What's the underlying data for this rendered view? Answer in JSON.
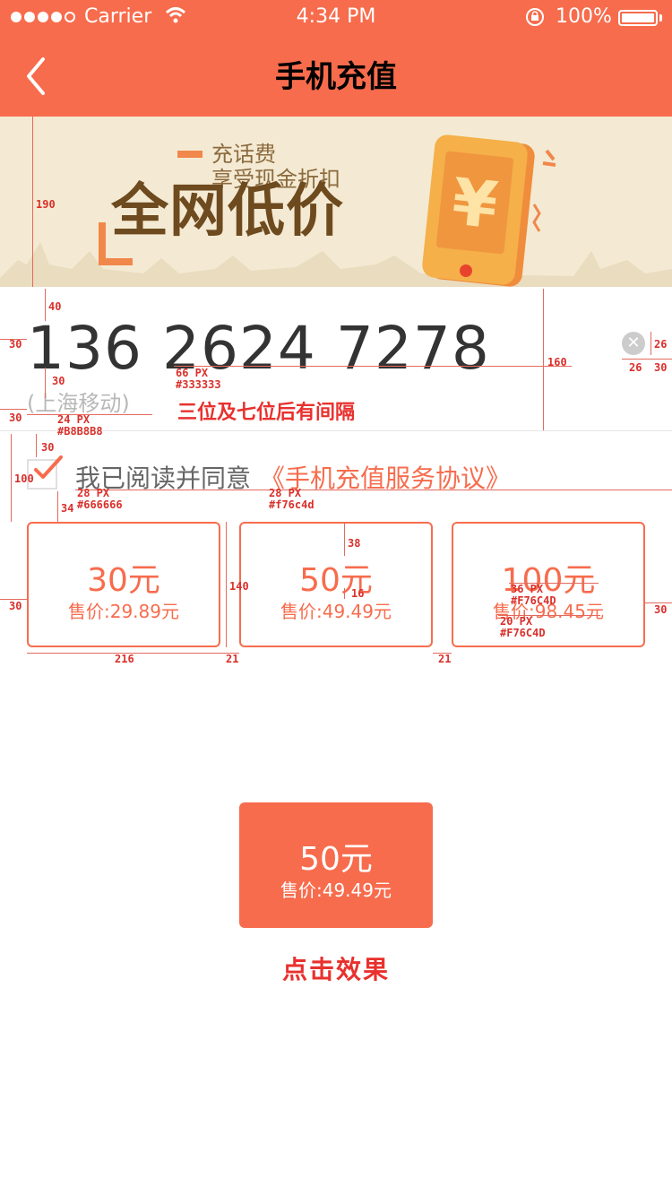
{
  "status_bar": {
    "carrier": "Carrier",
    "time": "4:34 PM",
    "battery": "100%"
  },
  "nav": {
    "title": "手机充值"
  },
  "banner": {
    "line1": "充话费",
    "line2": "享受现金折扣",
    "headline": "全网低价"
  },
  "phone": {
    "number": "136 2624 7278",
    "operator": "(上海移动)"
  },
  "agreement": {
    "text": "我已阅读并同意",
    "link": "《手机充值服务协议》",
    "checked": true
  },
  "options": [
    {
      "amount": "30元",
      "price": "售价:29.89元"
    },
    {
      "amount": "50元",
      "price": "售价:49.49元"
    },
    {
      "amount": "100元",
      "price": "售价:98.45元"
    }
  ],
  "pressed_option": {
    "amount": "50元",
    "price": "售价:49.49元"
  },
  "colors": {
    "accent": "#f76c4d",
    "phone_text": "#333333",
    "operator_text": "#b8b8b8",
    "agree_text": "#666666",
    "banner_bg": "#f4ead3"
  },
  "annotations": {
    "banner_height": "190",
    "phone_top": "40",
    "left_30a": "30",
    "left_30b": "30",
    "gap_30": "30",
    "phone_size": "66 PX",
    "phone_color": "#333333",
    "operator_size": "24 PX",
    "operator_color": "#B8B8B8",
    "row_height": "160",
    "clear_size": "26",
    "clear_right_26": "26",
    "clear_right_30": "30",
    "agree_row": "100",
    "agree_top": "30",
    "agree_bottom": "34",
    "agree_size": "28 PX",
    "agree_color": "#666666",
    "link_size": "28 PX",
    "link_color": "#f76c4d",
    "opt_left": "30",
    "opt_height": "140",
    "opt_top_gap": "38",
    "opt_mid_gap": "16",
    "opt_amount_size": "36 PX",
    "opt_amount_color": "#F76C4D",
    "opt_price_size": "20 PX",
    "opt_price_color": "#F76C4D",
    "opt_right": "30",
    "opt_width": "216",
    "opt_gap1": "21",
    "opt_gap2": "21",
    "spacing_note": "三位及七位后有间隔",
    "click_note": "点击效果"
  }
}
